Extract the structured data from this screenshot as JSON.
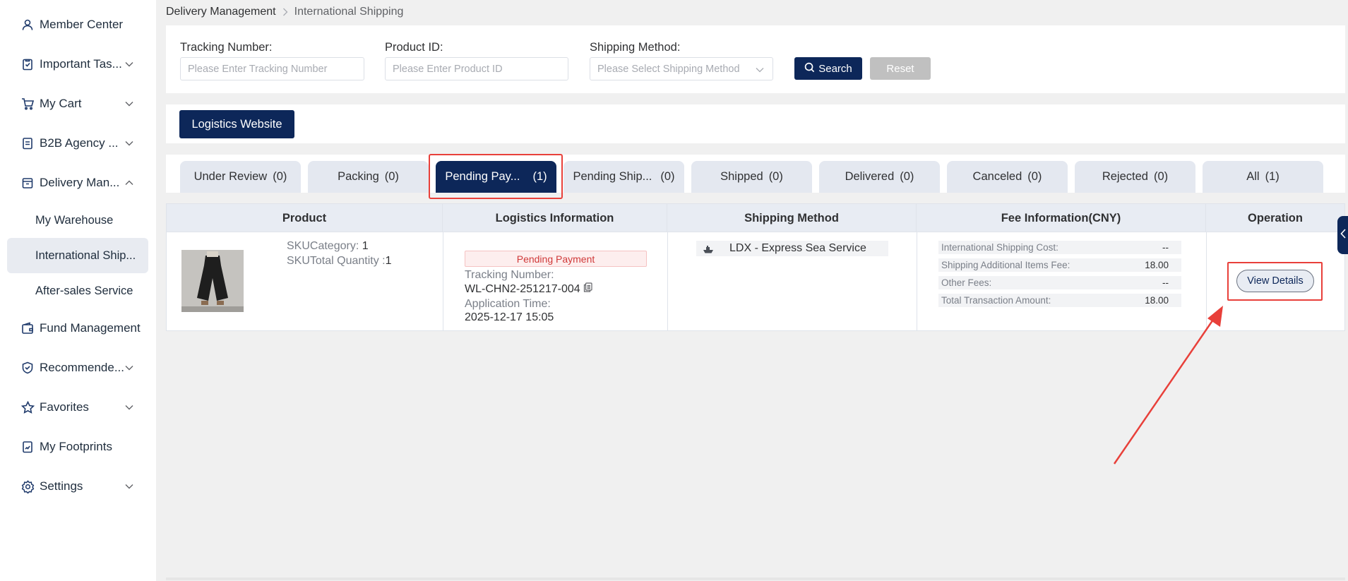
{
  "sidebar": {
    "items": [
      {
        "label": "Member Center",
        "icon": "user-icon",
        "has_chevron": false
      },
      {
        "label": "Important Tas...",
        "icon": "clipboard-check-icon",
        "has_chevron": true
      },
      {
        "label": "My Cart",
        "icon": "cart-icon",
        "has_chevron": true
      },
      {
        "label": "B2B Agency ...",
        "icon": "document-icon",
        "has_chevron": true
      },
      {
        "label": "Delivery Man...",
        "icon": "box-icon",
        "has_chevron": true,
        "expanded": true
      },
      {
        "label": "Fund Management",
        "icon": "wallet-icon",
        "has_chevron": false
      },
      {
        "label": "Recommende...",
        "icon": "badge-icon",
        "has_chevron": true
      },
      {
        "label": "Favorites",
        "icon": "star-icon",
        "has_chevron": true
      },
      {
        "label": "My Footprints",
        "icon": "footprints-icon",
        "has_chevron": false
      },
      {
        "label": "Settings",
        "icon": "gear-icon",
        "has_chevron": true
      }
    ],
    "sub_items": [
      {
        "label": "My Warehouse"
      },
      {
        "label": "International Ship...",
        "active": true
      },
      {
        "label": "After-sales Service"
      }
    ]
  },
  "breadcrumb": {
    "first": "Delivery Management",
    "current": "International Shipping"
  },
  "search": {
    "tracking_label": "Tracking Number:",
    "tracking_placeholder": "Please Enter Tracking Number",
    "product_label": "Product ID:",
    "product_placeholder": "Please Enter Product ID",
    "method_label": "Shipping Method:",
    "method_placeholder": "Please Select Shipping Method",
    "search_button": "Search",
    "reset_button": "Reset"
  },
  "logistics_button": "Logistics Website",
  "tabs": [
    {
      "label": "Under Review",
      "count": "(0)"
    },
    {
      "label": "Packing",
      "count": "(0)"
    },
    {
      "label": "Pending Pay...",
      "count": "(1)",
      "active": true
    },
    {
      "label": "Pending Ship...",
      "count": "(0)"
    },
    {
      "label": "Shipped",
      "count": "(0)"
    },
    {
      "label": "Delivered",
      "count": "(0)"
    },
    {
      "label": "Canceled",
      "count": "(0)"
    },
    {
      "label": "Rejected",
      "count": "(0)"
    },
    {
      "label": "All",
      "count": "(1)"
    }
  ],
  "table": {
    "headers": [
      "Product",
      "Logistics Information",
      "Shipping Method",
      "Fee Information(CNY)",
      "Operation"
    ],
    "row": {
      "sku_category_label": "SKUCategory:",
      "sku_category_value": "1",
      "sku_quantity_label": "SKUTotal Quantity :",
      "sku_quantity_value": "1",
      "status_badge": "Pending Payment",
      "tracking_label": "Tracking Number:",
      "tracking_value": "WL-CHN2-251217-004",
      "application_label": "Application Time:",
      "application_value": "2025-12-17 15:05",
      "shipping_method": "LDX - Express Sea Service",
      "fees": [
        {
          "label": "International Shipping Cost:",
          "value": "--"
        },
        {
          "label": "Shipping Additional Items Fee:",
          "value": "18.00"
        },
        {
          "label": "Other Fees:",
          "value": "--"
        },
        {
          "label": "Total Transaction Amount:",
          "value": "18.00"
        }
      ],
      "view_details": "View Details"
    }
  },
  "colors": {
    "primary": "#0d2759",
    "highlight": "#e8403a",
    "status_red": "#d03939"
  }
}
